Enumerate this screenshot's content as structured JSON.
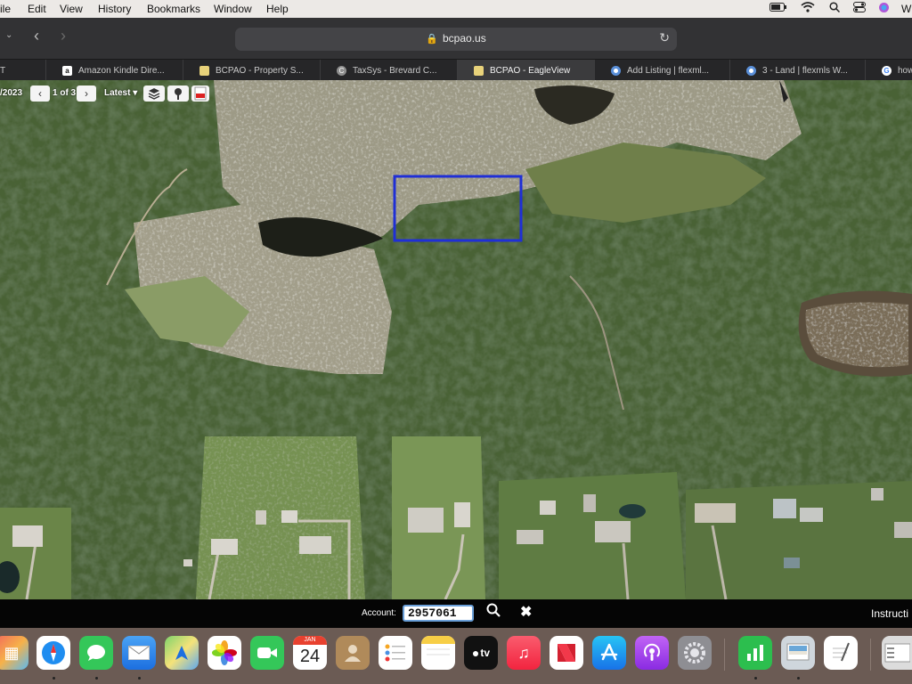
{
  "menubar": {
    "items": [
      "ile",
      "Edit",
      "View",
      "History",
      "Bookmarks",
      "Window",
      "Help"
    ],
    "right_text": "W"
  },
  "browser": {
    "url": "bcpao.us",
    "tabs": [
      {
        "label": "T",
        "favicon": "",
        "active": false
      },
      {
        "label": "Amazon Kindle Dire...",
        "favicon": "amazon-icon",
        "active": false
      },
      {
        "label": "BCPAO - Property S...",
        "favicon": "bcpao-icon",
        "active": false
      },
      {
        "label": "TaxSys - Brevard C...",
        "favicon": "taxsys-icon",
        "active": false
      },
      {
        "label": "BCPAO - EagleView",
        "favicon": "bcpao-icon",
        "active": true
      },
      {
        "label": "Add Listing | flexml...",
        "favicon": "flexmls-icon",
        "active": false
      },
      {
        "label": "3 - Land | flexmls W...",
        "favicon": "flexmls-icon",
        "active": false
      },
      {
        "label": "how",
        "favicon": "google-icon",
        "active": false
      }
    ]
  },
  "map_controls": {
    "date_fragment": "/2023",
    "page_indicator": "1 of 3",
    "imagery_select": "Latest"
  },
  "footer": {
    "account_label": "Account:",
    "account_value": "2957061",
    "instructions": "Instructi"
  },
  "dock": {
    "items": [
      "launchpad-icon",
      "safari-icon",
      "messages-icon",
      "mail-icon",
      "maps-icon",
      "photos-icon",
      "facetime-icon",
      "calendar-icon",
      "contacts-icon",
      "reminders-icon",
      "notes-icon",
      "apple-tv-icon",
      "music-icon",
      "news-icon",
      "app-store-icon",
      "podcasts-icon",
      "system-settings-icon",
      "numbers-icon",
      "preview-icon",
      "textedit-icon",
      "finder-window-icon"
    ],
    "calendar": {
      "month": "JAN",
      "day": "24"
    },
    "tv_label": "tv"
  },
  "colors": {
    "parcel_outline": "#1f2fd6",
    "forest": "#3f5530",
    "wetland": "#9d9a86"
  }
}
